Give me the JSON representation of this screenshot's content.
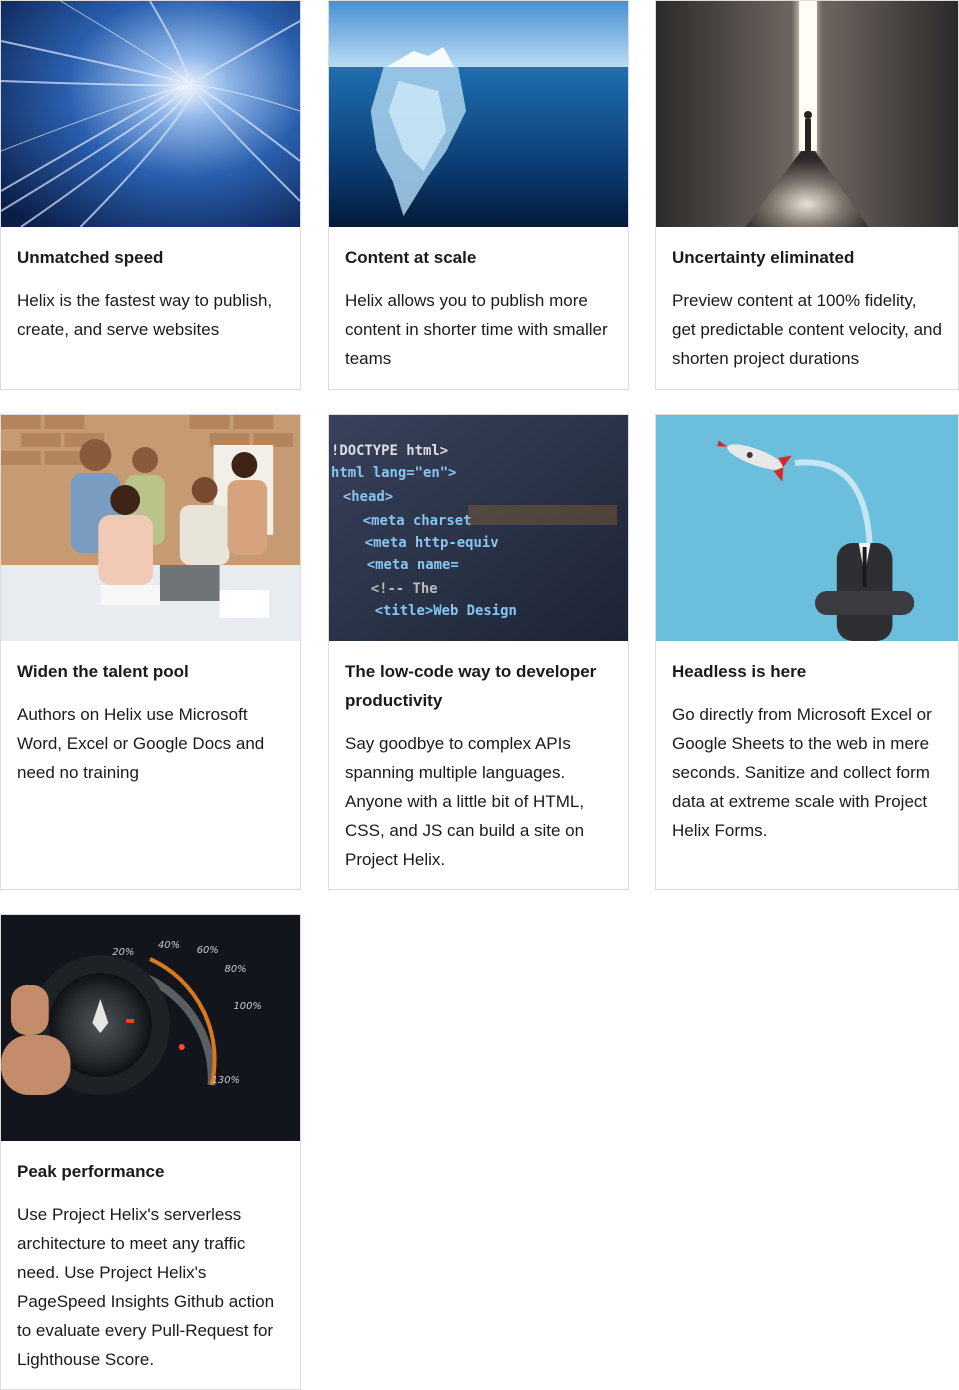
{
  "cards": [
    {
      "title": "Unmatched speed",
      "description": "Helix is the fastest way to publish, create, and serve websites",
      "image": "speed-tunnel-image"
    },
    {
      "title": "Content at scale",
      "description": "Helix allows you to publish more content in shorter time with smaller teams",
      "image": "iceberg-image"
    },
    {
      "title": "Uncertainty eliminated",
      "description": "Preview content at 100% fidelity, get predictable content velocity, and shorten project durations",
      "image": "light-doorway-image"
    },
    {
      "title": "Widen the talent pool",
      "description": "Authors on Helix use Microsoft Word, Excel or Google Docs and need no training",
      "image": "team-meeting-image"
    },
    {
      "title": "The low-code way to developer productivity",
      "description": "Say goodbye to complex APIs spanning multiple languages. Anyone with a little bit of HTML, CSS, and JS can build a site on Project Helix.",
      "image": "html-code-image"
    },
    {
      "title": "Headless is here",
      "description": "Go directly from Microsoft Excel or Google Sheets to the web in mere seconds. Sanitize and collect form data at extreme scale with Project Helix Forms.",
      "image": "headless-rocket-image"
    },
    {
      "title": "Peak performance",
      "description": "Use Project Helix's serverless architecture to meet any traffic need. Use Project Helix's PageSpeed Insights Github action to evaluate every Pull-Request for Lighthouse Score.",
      "image": "performance-dial-image"
    }
  ],
  "code_image_lines": [
    "!DOCTYPE html>",
    "html lang=\"en\">",
    "<head>",
    "<meta charset",
    "<meta http-equiv",
    "<meta name=",
    "<!-- The",
    "<title>Web Design"
  ],
  "dial_image_labels": [
    "20%",
    "40%",
    "60%",
    "80%",
    "100%",
    "130%"
  ]
}
